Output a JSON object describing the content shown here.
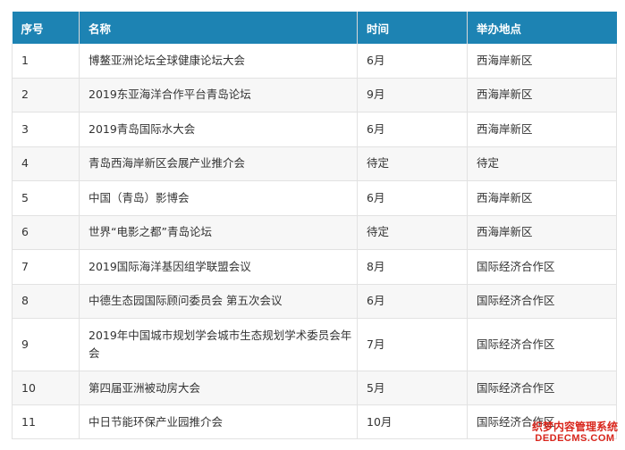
{
  "table": {
    "headers": [
      "序号",
      "名称",
      "时间",
      "举办地点"
    ],
    "rows": [
      {
        "no": "1",
        "name": "博鳌亚洲论坛全球健康论坛大会",
        "time": "6月",
        "venue": "西海岸新区"
      },
      {
        "no": "2",
        "name": "2019东亚海洋合作平台青岛论坛",
        "time": "9月",
        "venue": "西海岸新区"
      },
      {
        "no": "3",
        "name": "2019青岛国际水大会",
        "time": "6月",
        "venue": "西海岸新区"
      },
      {
        "no": "4",
        "name": "青岛西海岸新区会展产业推介会",
        "time": "待定",
        "venue": "待定"
      },
      {
        "no": "5",
        "name": "中国（青岛）影博会",
        "time": "6月",
        "venue": "西海岸新区"
      },
      {
        "no": "6",
        "name": "世界“电影之都”青岛论坛",
        "time": "待定",
        "venue": "西海岸新区"
      },
      {
        "no": "7",
        "name": "2019国际海洋基因组学联盟会议",
        "time": "8月",
        "venue": "国际经济合作区"
      },
      {
        "no": "8",
        "name": "中德生态园国际顾问委员会 第五次会议",
        "time": "6月",
        "venue": "国际经济合作区"
      },
      {
        "no": "9",
        "name": "2019年中国城市规划学会城市生态规划学术委员会年会",
        "time": "7月",
        "venue": "国际经济合作区"
      },
      {
        "no": "10",
        "name": "第四届亚洲被动房大会",
        "time": "5月",
        "venue": "国际经济合作区"
      },
      {
        "no": "11",
        "name": "中日节能环保产业园推介会",
        "time": "10月",
        "venue": "国际经济合作区"
      }
    ]
  },
  "watermark": {
    "line1": "织梦内容管理系统",
    "line2": "DEDECMS.COM"
  }
}
